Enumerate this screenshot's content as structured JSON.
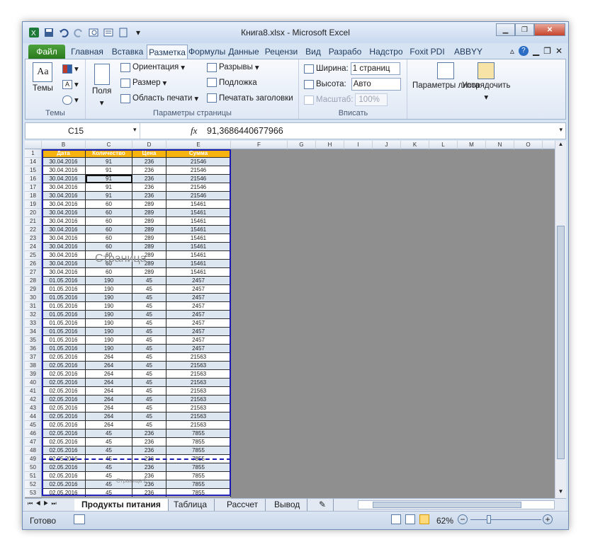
{
  "window": {
    "title": "Книга8.xlsx - Microsoft Excel"
  },
  "tabs": [
    "Файл",
    "Главная",
    "Вставка",
    "Разметка",
    "Формулы",
    "Данные",
    "Рецензи",
    "Вид",
    "Разрабо",
    "Надстро",
    "Foxit PDI",
    "ABBYY PL"
  ],
  "ribbon": {
    "themes": {
      "label": "Темы",
      "group": "Темы"
    },
    "fields_label": "Поля",
    "orientation": "Ориентация",
    "size": "Размер",
    "print_area": "Область печати",
    "breaks": "Разрывы",
    "background": "Подложка",
    "print_titles": "Печатать заголовки",
    "page_setup_group": "Параметры страницы",
    "width_label": "Ширина:",
    "width_value": "1 страниц",
    "height_label": "Высота:",
    "height_value": "Авто",
    "scale_label": "Масштаб:",
    "scale_value": "100%",
    "fit_group": "Вписать",
    "sheet_options": "Параметры листа",
    "arrange": "Упорядочить"
  },
  "formula_bar": {
    "name_box": "C15",
    "fx": "fx",
    "formula": "91,3686440677966"
  },
  "columns": [
    "B",
    "C",
    "D",
    "E",
    "F",
    "G",
    "H",
    "I",
    "J",
    "K",
    "L",
    "M",
    "N",
    "O"
  ],
  "table": {
    "headers": [
      "Дата",
      "Количество",
      "Цена",
      "Сумма"
    ],
    "rows": [
      [
        "14",
        "30.04.2016",
        "91",
        "236",
        "21546"
      ],
      [
        "15",
        "30.04.2016",
        "91",
        "236",
        "21546"
      ],
      [
        "16",
        "30.04.2016",
        "91",
        "236",
        "21546"
      ],
      [
        "17",
        "30.04.2016",
        "91",
        "236",
        "21546"
      ],
      [
        "18",
        "30.04.2016",
        "91",
        "236",
        "21546"
      ],
      [
        "19",
        "30.04.2016",
        "60",
        "289",
        "15461"
      ],
      [
        "20",
        "30.04.2016",
        "60",
        "289",
        "15461"
      ],
      [
        "21",
        "30.04.2016",
        "60",
        "289",
        "15461"
      ],
      [
        "22",
        "30.04.2016",
        "60",
        "289",
        "15461"
      ],
      [
        "23",
        "30.04.2016",
        "60",
        "289",
        "15461"
      ],
      [
        "24",
        "30.04.2016",
        "60",
        "289",
        "15461"
      ],
      [
        "25",
        "30.04.2016",
        "60",
        "289",
        "15461"
      ],
      [
        "26",
        "30.04.2016",
        "60",
        "289",
        "15461"
      ],
      [
        "27",
        "30.04.2016",
        "60",
        "289",
        "15461"
      ],
      [
        "28",
        "01.05.2016",
        "190",
        "45",
        "2457"
      ],
      [
        "29",
        "01.05.2016",
        "190",
        "45",
        "2457"
      ],
      [
        "30",
        "01.05.2016",
        "190",
        "45",
        "2457"
      ],
      [
        "31",
        "01.05.2016",
        "190",
        "45",
        "2457"
      ],
      [
        "32",
        "01.05.2016",
        "190",
        "45",
        "2457"
      ],
      [
        "33",
        "01.05.2016",
        "190",
        "45",
        "2457"
      ],
      [
        "34",
        "01.05.2016",
        "190",
        "45",
        "2457"
      ],
      [
        "35",
        "01.05.2016",
        "190",
        "45",
        "2457"
      ],
      [
        "36",
        "01.05.2016",
        "190",
        "45",
        "2457"
      ],
      [
        "37",
        "02.05.2016",
        "264",
        "45",
        "21563"
      ],
      [
        "38",
        "02.05.2016",
        "264",
        "45",
        "21563"
      ],
      [
        "39",
        "02.05.2016",
        "264",
        "45",
        "21563"
      ],
      [
        "40",
        "02.05.2016",
        "264",
        "45",
        "21563"
      ],
      [
        "41",
        "02.05.2016",
        "264",
        "45",
        "21563"
      ],
      [
        "42",
        "02.05.2016",
        "264",
        "45",
        "21563"
      ],
      [
        "43",
        "02.05.2016",
        "264",
        "45",
        "21563"
      ],
      [
        "44",
        "02.05.2016",
        "264",
        "45",
        "21563"
      ],
      [
        "45",
        "02.05.2016",
        "264",
        "45",
        "21563"
      ],
      [
        "46",
        "02.05.2016",
        "45",
        "236",
        "7855"
      ],
      [
        "47",
        "02.05.2016",
        "45",
        "236",
        "7855"
      ],
      [
        "48",
        "02.05.2016",
        "45",
        "236",
        "7855"
      ],
      [
        "49",
        "02.05.2016",
        "45",
        "236",
        "7855"
      ],
      [
        "50",
        "02.05.2016",
        "45",
        "236",
        "7855"
      ],
      [
        "51",
        "02.05.2016",
        "45",
        "236",
        "7855"
      ],
      [
        "52",
        "02.05.2016",
        "45",
        "236",
        "7855"
      ],
      [
        "53",
        "02.05.2016",
        "45",
        "236",
        "7855"
      ]
    ]
  },
  "page_labels": {
    "page1": "Страница",
    "page2": "Страница 2"
  },
  "sheet_tabs": [
    "Продукты питания",
    "Таблица",
    "Рассчет",
    "Вывод"
  ],
  "status": {
    "ready": "Готово",
    "zoom": "62%"
  },
  "colors": {
    "header": "#f6b30f",
    "shaded": "#dce6f1",
    "page_break": "#1a1ab0",
    "file_tab": "#2a7a1e"
  }
}
